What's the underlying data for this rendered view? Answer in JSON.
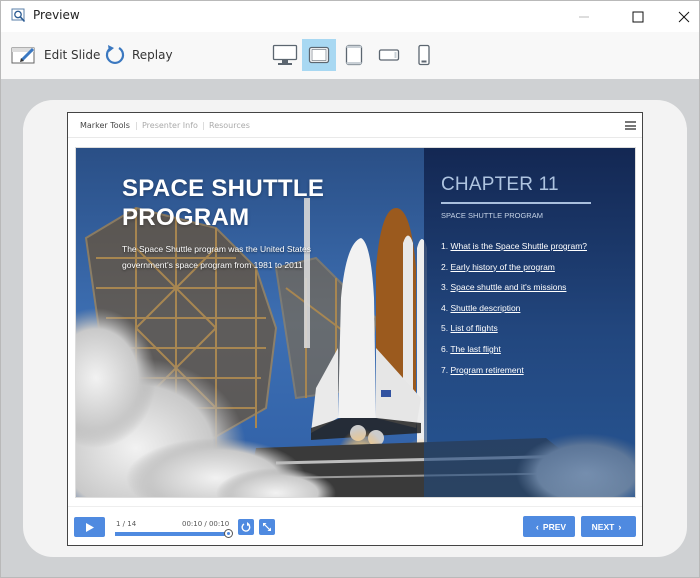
{
  "window": {
    "title": "Preview",
    "controls": {
      "minimize": "minimize",
      "maximize": "maximize",
      "close": "close"
    }
  },
  "toolbar": {
    "edit_slide_label": "Edit Slide",
    "replay_label": "Replay",
    "devices": [
      {
        "name": "desktop",
        "active": false
      },
      {
        "name": "tablet-landscape",
        "active": true
      },
      {
        "name": "tablet-portrait",
        "active": false
      },
      {
        "name": "phone-landscape",
        "active": false
      },
      {
        "name": "phone-portrait",
        "active": false
      }
    ]
  },
  "player": {
    "tabs": [
      "Marker Tools",
      "Presenter Info",
      "Resources"
    ],
    "separator": "|",
    "slide": {
      "title_line1": "SPACE SHUTTLE",
      "title_line2": "PROGRAM",
      "description": "The Space Shuttle program was the United States government’s space program from 1981 to 2011",
      "chapter": "CHAPTER 11",
      "chapter_subtitle": "SPACE SHUTTLE PROGRAM",
      "toc": [
        {
          "num": "1.",
          "label": "What is the Space Shuttle program?"
        },
        {
          "num": "2.",
          "label": "Early history of the program"
        },
        {
          "num": "3.",
          "label": "Space shuttle and it's missions"
        },
        {
          "num": "4.",
          "label": "Shuttle description"
        },
        {
          "num": "5.",
          "label": "List of flights"
        },
        {
          "num": "6.",
          "label": "The last flight"
        },
        {
          "num": "7.",
          "label": "Program retirement"
        }
      ]
    },
    "controls": {
      "slide_count": "1 / 14",
      "time": "00:10 / 00:10",
      "progress_percent": 100,
      "prev_label": "PREV",
      "next_label": "NEXT"
    }
  },
  "colors": {
    "accent": "#4f8ae0",
    "active_device": "#a8d8f2",
    "stage_bg": "#cfd1d3",
    "side_panel": "#1c3e73"
  }
}
